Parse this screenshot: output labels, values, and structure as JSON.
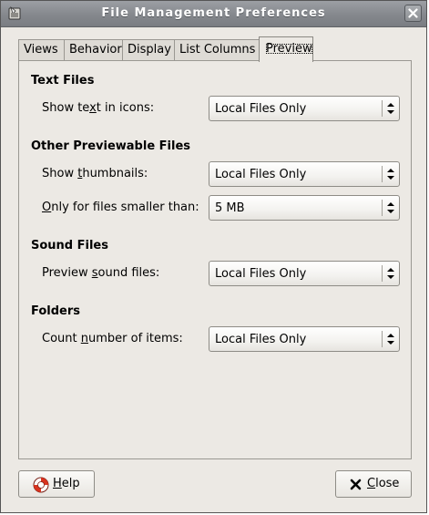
{
  "window": {
    "title": "File Management Preferences"
  },
  "tabs": [
    {
      "label": "Views"
    },
    {
      "label": "Behavior"
    },
    {
      "label": "Display"
    },
    {
      "label": "List Columns"
    },
    {
      "label": "Preview",
      "active": true
    }
  ],
  "sections": {
    "text_files": {
      "title": "Text Files",
      "show_text_in_icons": {
        "label_pre": "Show te",
        "label_mnemonic": "x",
        "label_post": "t in icons:",
        "value": "Local Files Only"
      }
    },
    "other_previewable": {
      "title": "Other Previewable Files",
      "show_thumbnails": {
        "label_pre": "Show ",
        "label_mnemonic": "t",
        "label_post": "humbnails:",
        "value": "Local Files Only"
      },
      "only_smaller_than": {
        "label_pre": "",
        "label_mnemonic": "O",
        "label_post": "nly for files smaller than:",
        "value": "5 MB"
      }
    },
    "sound_files": {
      "title": "Sound Files",
      "preview_sound": {
        "label_pre": "Preview ",
        "label_mnemonic": "s",
        "label_post": "ound files:",
        "value": "Local Files Only"
      }
    },
    "folders": {
      "title": "Folders",
      "count_items": {
        "label_pre": "Count ",
        "label_mnemonic": "n",
        "label_post": "umber of items:",
        "value": "Local Files Only"
      }
    }
  },
  "buttons": {
    "help": {
      "label_mnemonic": "H",
      "label_post": "elp",
      "icon": "help-lifebuoy-icon"
    },
    "close": {
      "label_mnemonic": "C",
      "label_post": "lose",
      "icon": "close-x-icon"
    }
  },
  "colors": {
    "titlebar": "#85888d",
    "window_bg": "#ece9e4",
    "help_icon_red": "#d8331f"
  }
}
